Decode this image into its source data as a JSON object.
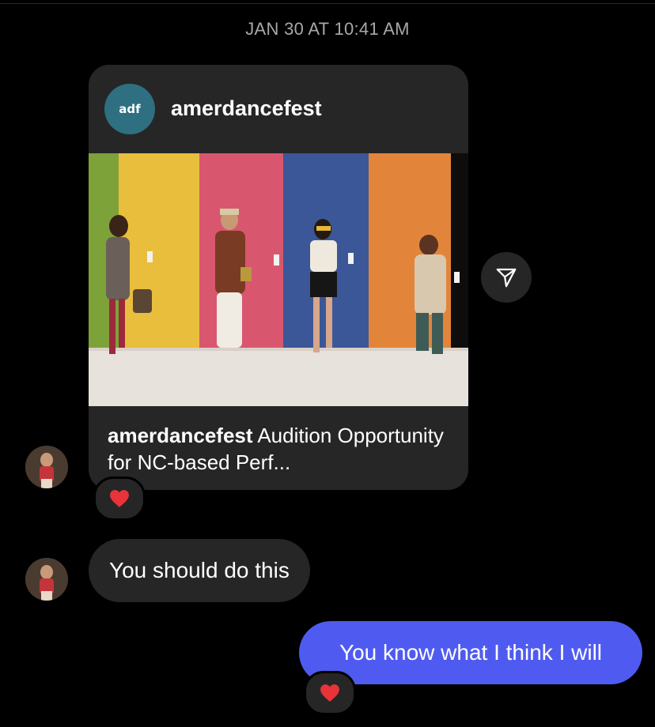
{
  "thread": {
    "timestamp": "JAN 30 AT 10:41 AM"
  },
  "shared_post": {
    "avatar_logo": "adf",
    "username": "amerdancefest",
    "caption_user": "amerdancefest",
    "caption_text": " Audition Opportunity for NC-based Perf...",
    "reaction": "❤️",
    "share_icon": "send-icon"
  },
  "messages": {
    "incoming": {
      "text": "You should do this"
    },
    "outgoing": {
      "text": "You know what I think I will",
      "reaction": "❤️"
    }
  },
  "colors": {
    "background": "#000000",
    "incoming_bubble": "#262626",
    "outgoing_bubble": "#4f5bf0",
    "timestamp": "#a8a8a8",
    "post_avatar": "#2f6f82"
  }
}
